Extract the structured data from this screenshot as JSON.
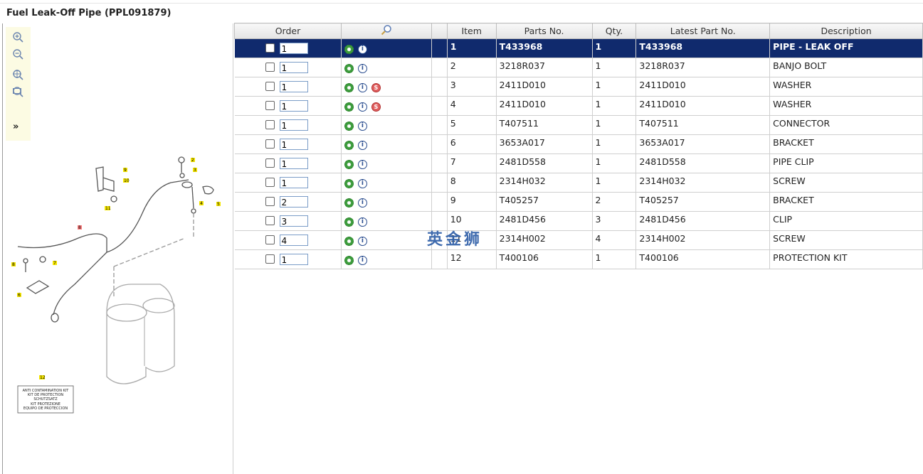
{
  "page": {
    "title": "Fuel Leak-Off Pipe (PPL091879)"
  },
  "toolbar": {
    "tools": [
      {
        "name": "zoom-in-icon"
      },
      {
        "name": "zoom-out-icon"
      },
      {
        "name": "zoom-fit-icon"
      },
      {
        "name": "zoom-window-icon"
      }
    ],
    "expand_label": "»"
  },
  "diagram": {
    "callouts": [
      "1",
      "2",
      "3",
      "4",
      "5",
      "6",
      "7",
      "8",
      "9",
      "10",
      "11",
      "12"
    ],
    "kit_label_lines": [
      "ANTI CONTAMINATION KIT",
      "KIT DE PROTECTION",
      "SCHUTZSATZ",
      "KIT PROTEZIONE",
      "EQUIPO DE PROTECCION"
    ]
  },
  "table": {
    "headers": {
      "order": "Order",
      "search_icon": "magnifier-icon",
      "blank": "",
      "item": "Item",
      "parts_no": "Parts No.",
      "qty": "Qty.",
      "latest_part_no": "Latest Part No.",
      "description": "Description"
    },
    "rows": [
      {
        "order": "1",
        "item": "1",
        "parts_no": "T433968",
        "qty": "1",
        "latest": "T433968",
        "desc": "PIPE - LEAK OFF",
        "s_icon": false,
        "selected": true
      },
      {
        "order": "1",
        "item": "2",
        "parts_no": "3218R037",
        "qty": "1",
        "latest": "3218R037",
        "desc": "BANJO BOLT",
        "s_icon": false
      },
      {
        "order": "1",
        "item": "3",
        "parts_no": "2411D010",
        "qty": "1",
        "latest": "2411D010",
        "desc": "WASHER",
        "s_icon": true
      },
      {
        "order": "1",
        "item": "4",
        "parts_no": "2411D010",
        "qty": "1",
        "latest": "2411D010",
        "desc": "WASHER",
        "s_icon": true
      },
      {
        "order": "1",
        "item": "5",
        "parts_no": "T407511",
        "qty": "1",
        "latest": "T407511",
        "desc": "CONNECTOR",
        "s_icon": false
      },
      {
        "order": "1",
        "item": "6",
        "parts_no": "3653A017",
        "qty": "1",
        "latest": "3653A017",
        "desc": "BRACKET",
        "s_icon": false
      },
      {
        "order": "1",
        "item": "7",
        "parts_no": "2481D558",
        "qty": "1",
        "latest": "2481D558",
        "desc": "PIPE CLIP",
        "s_icon": false
      },
      {
        "order": "1",
        "item": "8",
        "parts_no": "2314H032",
        "qty": "1",
        "latest": "2314H032",
        "desc": "SCREW",
        "s_icon": false
      },
      {
        "order": "2",
        "item": "9",
        "parts_no": "T405257",
        "qty": "2",
        "latest": "T405257",
        "desc": "BRACKET",
        "s_icon": false
      },
      {
        "order": "3",
        "item": "10",
        "parts_no": "2481D456",
        "qty": "3",
        "latest": "2481D456",
        "desc": "CLIP",
        "s_icon": false
      },
      {
        "order": "4",
        "item": "11",
        "parts_no": "2314H002",
        "qty": "4",
        "latest": "2314H002",
        "desc": "SCREW",
        "s_icon": false
      },
      {
        "order": "1",
        "item": "12",
        "parts_no": "T400106",
        "qty": "1",
        "latest": "T400106",
        "desc": "PROTECTION KIT",
        "s_icon": false
      }
    ]
  },
  "watermark": "英金狮",
  "colors": {
    "selected_row": "#102a6d",
    "toolbar_bg": "#fcfbe3",
    "gear": "#3c9c3c",
    "info": "#2a4d8f",
    "s_badge": "#e06060"
  }
}
